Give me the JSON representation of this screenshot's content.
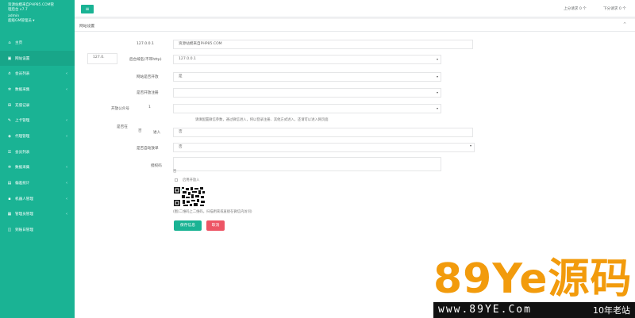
{
  "sidebar": {
    "brand_line1": "资源站模来自PHP85.COM管",
    "brand_line2": "理后台 v7.7",
    "user_name": "admin",
    "user_role": "超级GM管理员",
    "items": [
      {
        "label": "主页",
        "icon": "home-icon",
        "has_children": false,
        "active": false
      },
      {
        "label": "网站设置",
        "icon": "settings-icon",
        "has_children": false,
        "active": true
      },
      {
        "label": "会员列表",
        "icon": "users-icon",
        "has_children": true,
        "active": false
      },
      {
        "label": "数据采集",
        "icon": "gears-icon",
        "has_children": true,
        "active": false
      },
      {
        "label": "充值记录",
        "icon": "cart-icon",
        "has_children": false,
        "active": false
      },
      {
        "label": "上卡管理",
        "icon": "wrench-icon",
        "has_children": true,
        "active": false
      },
      {
        "label": "代理管理",
        "icon": "cube-icon",
        "has_children": true,
        "active": false
      },
      {
        "label": "会员列表",
        "icon": "list-icon",
        "has_children": false,
        "active": false
      },
      {
        "label": "数据采集",
        "icon": "gears-icon",
        "has_children": true,
        "active": false
      },
      {
        "label": "偏差统计",
        "icon": "chart-icon",
        "has_children": true,
        "active": false
      },
      {
        "label": "机器人管理",
        "icon": "robot-icon",
        "has_children": true,
        "active": false
      },
      {
        "label": "管理员管理",
        "icon": "admin-icon",
        "has_children": true,
        "active": false
      },
      {
        "label": "到账日管理",
        "icon": "calendar-icon",
        "has_children": false,
        "active": false
      }
    ]
  },
  "topbar": {
    "menu_icon": "menu-icon",
    "prev_request": "上分请求 0 个",
    "next_request": "下分请求 0 个"
  },
  "panel": {
    "title": "网站设置",
    "collapse_icon": "chevron-up-icon"
  },
  "form": {
    "ip_label": "127.0.0.1",
    "site_title_value": "资源站模来自PHP85.COM",
    "ip_side_value": "127.0.",
    "domain_label": "后台域名(不带http)",
    "domain_value": "127.0.0.1",
    "site_open_label": "网站是否开放",
    "site_open_value": "是",
    "register_label": "是否开放注册",
    "register_value": "",
    "wechat_label": "开放公众号",
    "wechat_value": "1",
    "config_hint": "请填配置微信参数，通过微信进入，将以登录注册、其他方式进入，还请可以进入网页面",
    "is_other_label": "是否在",
    "is_other_value": "否",
    "enter_label": "进入",
    "enter_value": "否",
    "auto_open_label": "是否自动放单",
    "auto_open_value": "否",
    "auth_code_label": "授权码",
    "auth_code_value": "否",
    "checkbox_label": "启用开放入",
    "qr_caption": "(图)二维码上二维码，扫描用来或直接在微信内访问)",
    "save_button": "保存信息",
    "cancel_button": "取消"
  },
  "watermark": {
    "brand": "89Ye源码",
    "url": "www.89YE.Com",
    "slogan": "10年老站"
  }
}
